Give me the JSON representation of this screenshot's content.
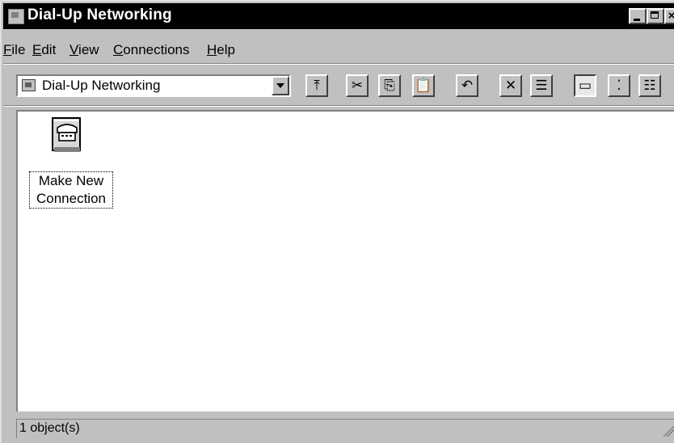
{
  "window": {
    "title": "Dial-Up Networking",
    "caption_buttons": {
      "minimize": "",
      "maximize": "",
      "close": "×"
    }
  },
  "menubar": {
    "items": [
      {
        "label": "File",
        "accel": "F",
        "rest": "ile"
      },
      {
        "label": "Edit",
        "accel": "E",
        "rest": "dit"
      },
      {
        "label": "View",
        "accel": "V",
        "rest": "iew"
      },
      {
        "label": "Connections",
        "accel": "C",
        "rest": "onnections"
      },
      {
        "label": "Help",
        "accel": "H",
        "rest": "elp"
      }
    ]
  },
  "toolbar": {
    "address_value": "Dial-Up Networking",
    "buttons": [
      {
        "icon": "up-folder-icon",
        "glyph": "⤒"
      },
      {
        "icon": "cut-icon",
        "glyph": "✂"
      },
      {
        "icon": "copy-icon",
        "glyph": "⎘"
      },
      {
        "icon": "paste-icon",
        "glyph": "📋"
      },
      {
        "icon": "undo-icon",
        "glyph": "↶"
      },
      {
        "icon": "delete-icon",
        "glyph": "✕"
      },
      {
        "icon": "properties-icon",
        "glyph": "☰"
      },
      {
        "icon": "large-icons-icon",
        "glyph": "▭"
      },
      {
        "icon": "small-icons-icon",
        "glyph": "⁚"
      },
      {
        "icon": "list-icon",
        "glyph": "☷"
      }
    ]
  },
  "content": {
    "items": [
      {
        "line1": "Make New",
        "line2": "Connection",
        "icon": "make-new-connection-icon"
      }
    ]
  },
  "statusbar": {
    "text": "1 object(s)"
  }
}
